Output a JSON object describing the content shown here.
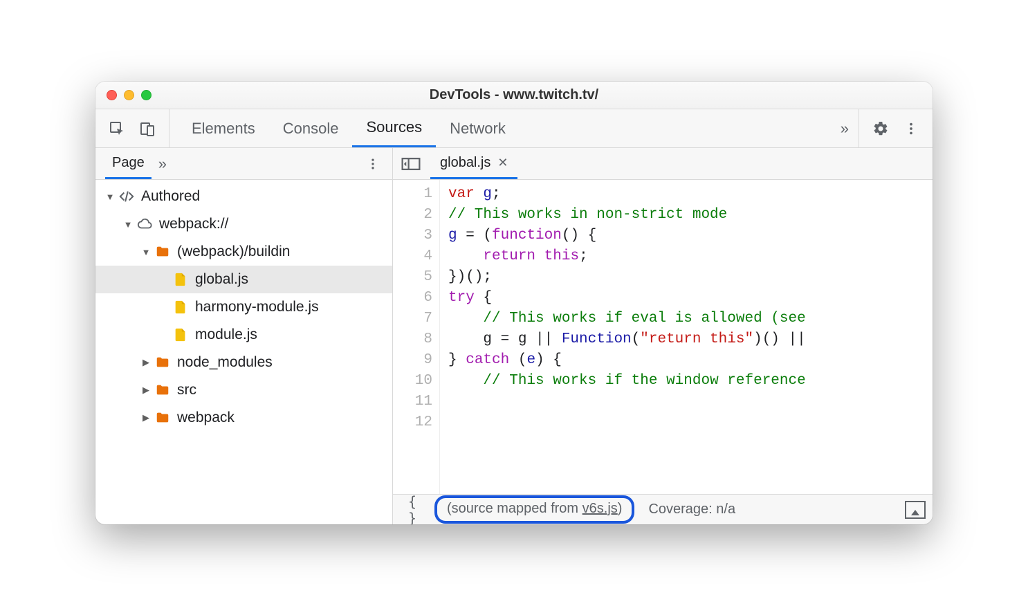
{
  "window": {
    "title": "DevTools - www.twitch.tv/"
  },
  "toolbar": {
    "tabs": [
      "Elements",
      "Console",
      "Sources",
      "Network"
    ],
    "active_tab": "Sources",
    "more_glyph": "»"
  },
  "left": {
    "tabs": [
      "Page"
    ],
    "active_tab": "Page",
    "more_glyph": "»",
    "tree": [
      {
        "depth": 0,
        "kind": "code",
        "label": "Authored",
        "expandable": true,
        "expanded": true
      },
      {
        "depth": 1,
        "kind": "cloud",
        "label": "webpack://",
        "expandable": true,
        "expanded": true
      },
      {
        "depth": 2,
        "kind": "folder",
        "label": "(webpack)/buildin",
        "expandable": true,
        "expanded": true
      },
      {
        "depth": 3,
        "kind": "file",
        "label": "global.js",
        "expandable": false,
        "selected": true
      },
      {
        "depth": 3,
        "kind": "file",
        "label": "harmony-module.js",
        "expandable": false
      },
      {
        "depth": 3,
        "kind": "file",
        "label": "module.js",
        "expandable": false
      },
      {
        "depth": 2,
        "kind": "folder",
        "label": "node_modules",
        "expandable": true,
        "expanded": false
      },
      {
        "depth": 2,
        "kind": "folder",
        "label": "src",
        "expandable": true,
        "expanded": false
      },
      {
        "depth": 2,
        "kind": "folder",
        "label": "webpack",
        "expandable": true,
        "expanded": false
      }
    ]
  },
  "editor": {
    "open_file": "global.js",
    "lines": [
      [
        {
          "t": "var ",
          "c": "kw2"
        },
        {
          "t": "g",
          "c": "ident"
        },
        {
          "t": ";",
          "c": "pun"
        }
      ],
      [
        {
          "t": "",
          "c": "pun"
        }
      ],
      [
        {
          "t": "// This works in non-strict mode",
          "c": "com"
        }
      ],
      [
        {
          "t": "g",
          "c": "ident"
        },
        {
          "t": " = (",
          "c": "pun"
        },
        {
          "t": "function",
          "c": "kw"
        },
        {
          "t": "() {",
          "c": "pun"
        }
      ],
      [
        {
          "t": "    ",
          "c": "pun"
        },
        {
          "t": "return ",
          "c": "kw"
        },
        {
          "t": "this",
          "c": "kw"
        },
        {
          "t": ";",
          "c": "pun"
        }
      ],
      [
        {
          "t": "})();",
          "c": "pun"
        }
      ],
      [
        {
          "t": "",
          "c": "pun"
        }
      ],
      [
        {
          "t": "try",
          "c": "kw"
        },
        {
          "t": " {",
          "c": "pun"
        }
      ],
      [
        {
          "t": "    ",
          "c": "pun"
        },
        {
          "t": "// This works if eval is allowed (see",
          "c": "com"
        }
      ],
      [
        {
          "t": "    g = g || ",
          "c": "pun"
        },
        {
          "t": "Function",
          "c": "ident"
        },
        {
          "t": "(",
          "c": "pun"
        },
        {
          "t": "\"return this\"",
          "c": "str"
        },
        {
          "t": ")() ||",
          "c": "pun"
        }
      ],
      [
        {
          "t": "} ",
          "c": "pun"
        },
        {
          "t": "catch",
          "c": "kw"
        },
        {
          "t": " (",
          "c": "pun"
        },
        {
          "t": "e",
          "c": "ident"
        },
        {
          "t": ") {",
          "c": "pun"
        }
      ],
      [
        {
          "t": "    ",
          "c": "pun"
        },
        {
          "t": "// This works if the window reference",
          "c": "com"
        }
      ]
    ]
  },
  "status": {
    "mapped_prefix": "(source mapped from ",
    "mapped_link": "v6s.js",
    "mapped_suffix": ")",
    "coverage_label": "Coverage: n/a"
  }
}
